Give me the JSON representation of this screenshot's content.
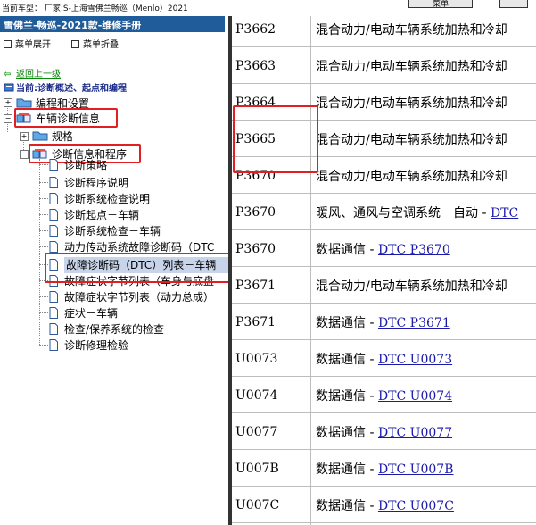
{
  "topbar": {
    "vehicle_text": "当前车型：  厂家:S-上海雪佛兰畅巡（Menlo）2021",
    "buttons": [
      {
        "label": "菜单"
      },
      {
        "label": ""
      }
    ]
  },
  "left_panel": {
    "header": "雪佛兰-畅巡-2021款-维修手册",
    "expand_label": "菜单展开",
    "collapse_label": "菜单折叠",
    "back_label": "返回上一级",
    "current_label": "当前:诊断概述、起点和编程",
    "tree": {
      "programming": "编程和设置",
      "vehicle_diag": "车辆诊断信息",
      "specs": "规格",
      "diag_info": "诊断信息和程序",
      "leaves": [
        "诊断策略",
        "诊断程序说明",
        "诊断系统检查说明",
        "诊断起点－车辆",
        "诊断系统检查－车辆",
        "动力传动系统故障诊断码（DTC",
        "故障诊断码（DTC）列表－车辆",
        "故障症状字节列表（车身与底盘",
        "故障症状字节列表（动力总成）",
        "症状－车辆",
        "检查/保养系统的检查",
        "诊断修理检验"
      ]
    }
  },
  "dtc_table": {
    "rows": [
      {
        "code": "P3662",
        "desc": "混合动力/电动车辆系统加热和冷却",
        "link": ""
      },
      {
        "code": "P3663",
        "desc": "混合动力/电动车辆系统加热和冷却",
        "link": ""
      },
      {
        "code": "P3664",
        "desc": "混合动力/电动车辆系统加热和冷却",
        "link": ""
      },
      {
        "code": "P3665",
        "desc": "混合动力/电动车辆系统加热和冷却",
        "link": ""
      },
      {
        "code": "P3670",
        "desc": "混合动力/电动车辆系统加热和冷却",
        "link": ""
      },
      {
        "code": "P3670",
        "desc": "暖风、通风与空调系统－自动 - ",
        "link": "DTC"
      },
      {
        "code": "P3670",
        "desc": "数据通信 - ",
        "link": "DTC P3670"
      },
      {
        "code": "P3671",
        "desc": "混合动力/电动车辆系统加热和冷却",
        "link": ""
      },
      {
        "code": "P3671",
        "desc": "数据通信 - ",
        "link": "DTC P3671"
      },
      {
        "code": "U0073",
        "desc": "数据通信 - ",
        "link": "DTC U0073"
      },
      {
        "code": "U0074",
        "desc": "数据通信 - ",
        "link": "DTC U0074"
      },
      {
        "code": "U0077",
        "desc": "数据通信 - ",
        "link": "DTC U0077"
      },
      {
        "code": "U007B",
        "desc": "数据通信 - ",
        "link": "DTC U007B"
      },
      {
        "code": "U007C",
        "desc": "数据通信 - ",
        "link": "DTC U007C"
      }
    ]
  },
  "colors": {
    "header_bg": "#1f5c99",
    "highlight_red": "#e02020",
    "link": "#1a1aaa",
    "selected_bg": "#c8d4ea"
  }
}
